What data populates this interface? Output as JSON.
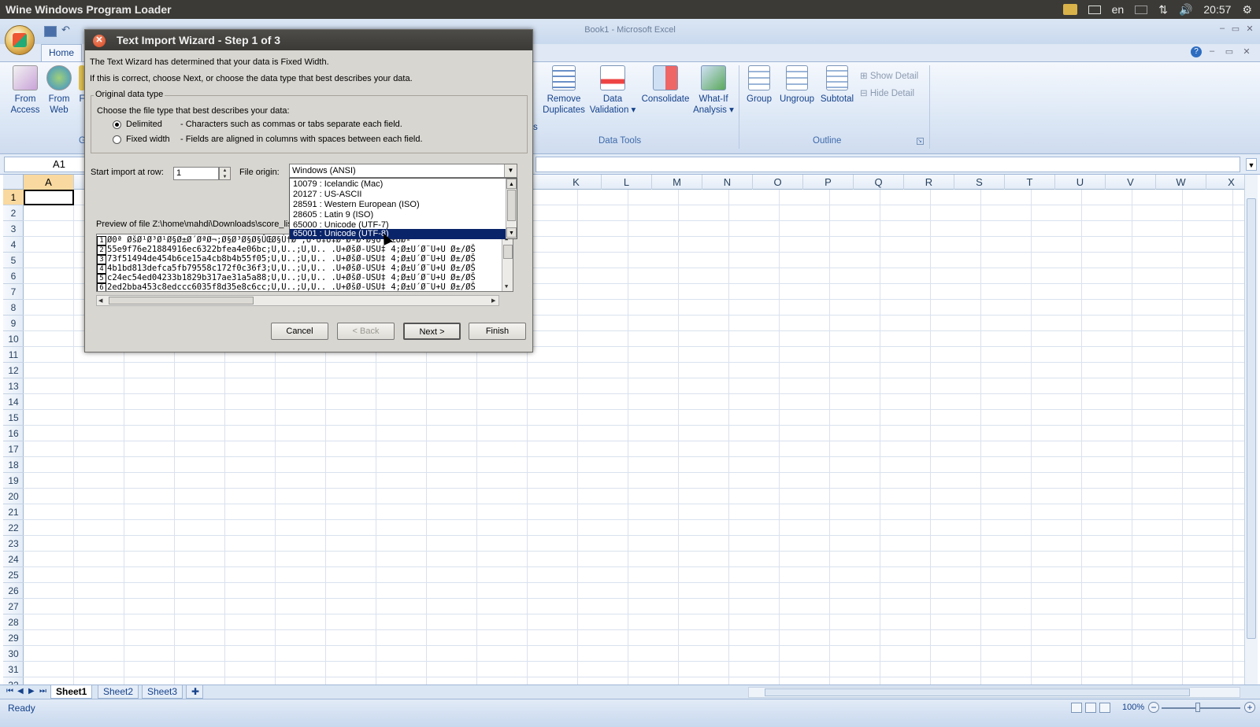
{
  "topbar": {
    "title": "Wine Windows Program Loader",
    "lang": "en",
    "clock": "20:57"
  },
  "excel": {
    "window_title": "Book1 - Microsoft Excel",
    "tabs": {
      "home": "Home"
    },
    "ribbon": {
      "from_access": [
        "From",
        "Access"
      ],
      "from_web": [
        "From",
        "Web"
      ],
      "partial_label": "F",
      "partial_group": "G",
      "remove_dup_suffix": "s",
      "remove_duplicates": [
        "Remove",
        "Duplicates"
      ],
      "data_validation": [
        "Data",
        "Validation ▾"
      ],
      "consolidate": "Consolidate",
      "what_if": [
        "What-If",
        "Analysis ▾"
      ],
      "data_tools_label": "Data Tools",
      "group": "Group",
      "ungroup": "Ungroup",
      "subtotal": "Subtotal",
      "show_detail": "Show Detail",
      "hide_detail": "Hide Detail",
      "outline_label": "Outline"
    },
    "namebox": "A1",
    "columns_left": [
      "A"
    ],
    "columns_right": [
      "K",
      "L",
      "M",
      "N",
      "O",
      "P",
      "Q",
      "R",
      "S",
      "T",
      "U",
      "V",
      "W",
      "X"
    ],
    "rows": [
      "1",
      "2",
      "3",
      "4",
      "5",
      "6",
      "7",
      "8",
      "9",
      "10",
      "11",
      "12",
      "13",
      "14",
      "15",
      "16",
      "17",
      "18",
      "19",
      "20",
      "21",
      "22",
      "23",
      "24",
      "25",
      "26",
      "27",
      "28",
      "29",
      "30",
      "31",
      "32"
    ],
    "sheets": [
      "Sheet1",
      "Sheet2",
      "Sheet3"
    ],
    "status": "Ready",
    "zoom": "100%"
  },
  "dialog": {
    "title": "Text Import Wizard - Step 1 of 3",
    "line1": "The Text Wizard has determined that your data is Fixed Width.",
    "line2": "If this is correct, choose Next, or choose the data type that best describes your data.",
    "group_legend": "Original data type",
    "choose_text": "Choose the file type that best describes your data:",
    "radio_delimited": "Delimited",
    "radio_delimited_desc": "- Characters such as commas or tabs separate each field.",
    "radio_fixed": "Fixed width",
    "radio_fixed_desc": "- Fields are aligned in columns with spaces between each field.",
    "start_row_label": "Start import at row:",
    "start_row_value": "1",
    "file_origin_label": "File origin:",
    "file_origin_value": "Windows (ANSI)",
    "options": [
      "10079 : Icelandic (Mac)",
      "20127 : US-ASCII",
      "28591 : Western European (ISO)",
      "28605 : Latin 9 (ISO)",
      "65000 : Unicode (UTF-7)",
      "65001 : Unicode (UTF-8)"
    ],
    "preview_label": "Preview of file Z:\\home\\mahdi\\Downloads\\score_list",
    "preview_rows": [
      {
        "n": "1",
        "text": "Ø0ª ØšØ¹Ø³Ø¹Ø§Ø±Ø´ØªØ¬;Ø§Ø³Ø§Ø§ÛŒØ§Ù†Ø¨;Ù·Ù‡Ù‡Ø³ØªØ·Ø§Ú¯Ø±ÙØª"
      },
      {
        "n": "2",
        "text": "55e9f76e21884916ec6322bfea4e06bc;U,U..;U,U.. .U+ØšØ-USU‡ 4;Ø±U´Ø¨U+U Ø±/ØŠ"
      },
      {
        "n": "3",
        "text": "73f51494de454b6ce15a4cb8b4b55f05;U,U..;U,U.. .U+ØšØ-USU‡ 4;Ø±U´Ø¨U+U Ø±/ØŠ"
      },
      {
        "n": "4",
        "text": "4b1bd813defca5fb79558c172f0c36f3;U,U..;U,U.. .U+ØšØ-USU‡ 4;Ø±U´Ø¨U+U Ø±/ØŠ"
      },
      {
        "n": "5",
        "text": "c24ec54ed04233b1829b317ae31a5a88;U,U..;U,U.. .U+ØšØ-USU‡ 4;Ø±U´Ø¨U+U Ø±/ØŠ"
      },
      {
        "n": "6",
        "text": "2ed2bba453c8edccc6035f8d35e8c6cc;U,U..;U,U.. .U+ØšØ-USU‡ 4;Ø±U´Ø¨U+U Ø±/ØŠ"
      }
    ],
    "btn_cancel": "Cancel",
    "btn_back": "< Back",
    "btn_next": "Next >",
    "btn_finish": "Finish"
  }
}
